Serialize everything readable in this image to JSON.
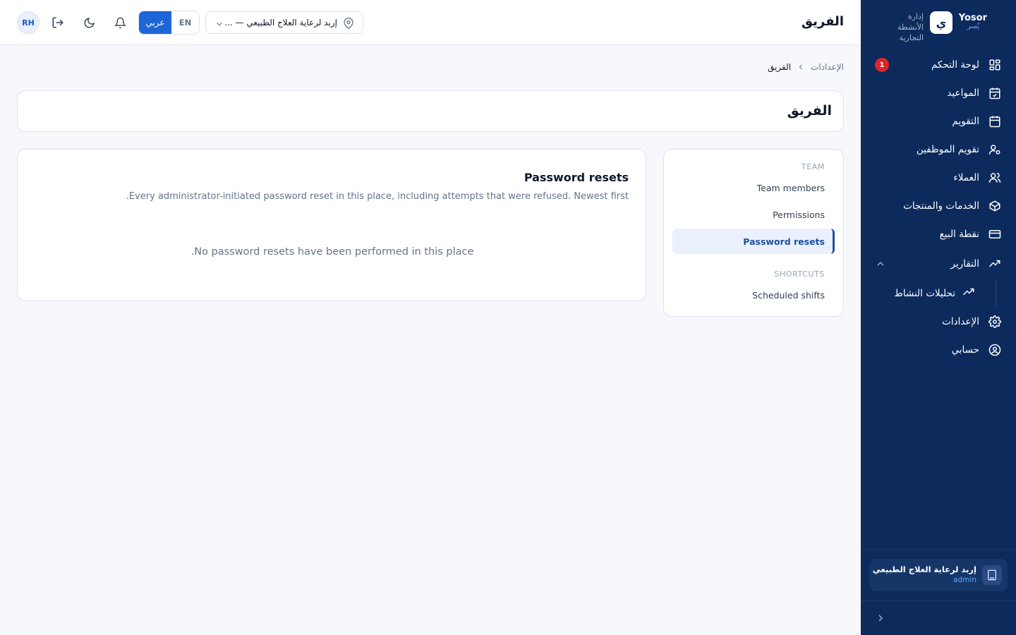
{
  "brand": {
    "name": "Yosor",
    "name_ar": "يُسر",
    "logo_glyph": "ي",
    "tagline": "إدارة الأنشطة التجارية"
  },
  "sidebar": {
    "items": [
      {
        "label": "لوحة التحكم",
        "icon": "dashboard-icon",
        "badge": "1"
      },
      {
        "label": "المواعيد",
        "icon": "calendar-check-icon"
      },
      {
        "label": "التقويم",
        "icon": "calendar-icon"
      },
      {
        "label": "تقويم الموظفين",
        "icon": "user-settings-icon"
      },
      {
        "label": "العملاء",
        "icon": "users-icon"
      },
      {
        "label": "الخدمات والمنتجات",
        "icon": "box-icon"
      },
      {
        "label": "نقطة البيع",
        "icon": "credit-card-icon"
      },
      {
        "label": "التقارير",
        "icon": "trending-up-icon",
        "expanded": true
      },
      {
        "label": "تحليلات النشاط",
        "icon": "trending-up-icon",
        "sub": true
      },
      {
        "label": "الإعدادات",
        "icon": "gear-icon"
      },
      {
        "label": "حسابي",
        "icon": "user-circle-icon"
      }
    ],
    "org": {
      "name": "إربد لرعاية العلاج الطبيعي",
      "role": "admin"
    }
  },
  "header": {
    "title": "الفريق",
    "location": "إربد لرعاية العلاج الطبيعي — ...",
    "lang_ar": "عربي",
    "lang_en": "EN",
    "avatar_initials": "RH",
    "colors": {
      "primary": "#1d66d8",
      "sidebar": "#0c2a5c",
      "badge": "#dc2626"
    }
  },
  "breadcrumb": {
    "parent": "الإعدادات",
    "current": "الفريق"
  },
  "page": {
    "title": "الفريق"
  },
  "menu": {
    "team_section": "TEAM",
    "team_members": "Team members",
    "permissions": "Permissions",
    "password_resets": "Password resets",
    "shortcuts_section": "SHORTCUTS",
    "scheduled_shifts": "Scheduled shifts"
  },
  "content": {
    "title": "Password resets",
    "description": "Every administrator-initiated password reset in this place, including attempts that were refused. Newest first.",
    "empty": "No password resets have been performed in this place."
  }
}
